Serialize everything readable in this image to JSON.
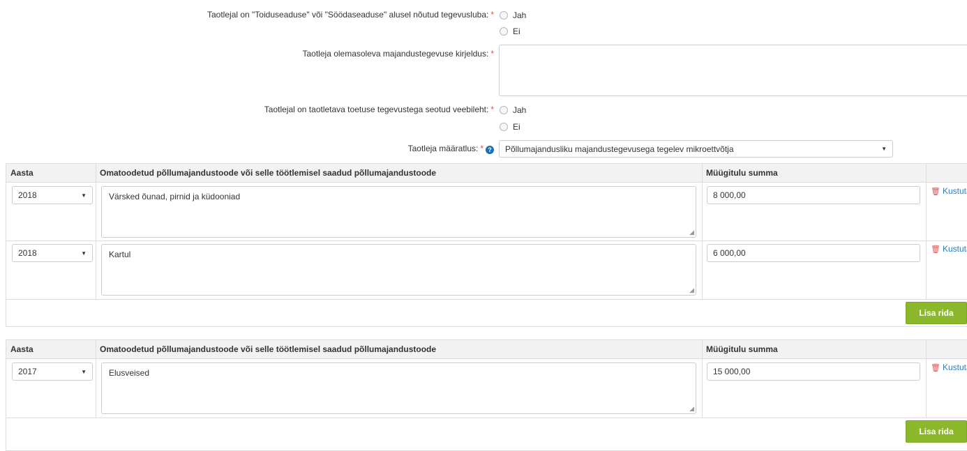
{
  "form": {
    "food_license": {
      "label": "Taotlejal on \"Toiduseaduse\" või \"Söödaseaduse\" alusel nõutud tegevusluba:",
      "required": "*",
      "options": [
        "Jah",
        "Ei"
      ]
    },
    "business_description": {
      "label": "Taotleja olemasoleva majandustegevuse kirjeldus:",
      "required": "*",
      "value": ""
    },
    "website": {
      "label": "Taotlejal on taotletava toetuse tegevustega seotud veebileht:",
      "required": "*",
      "options": [
        "Jah",
        "Ei"
      ]
    },
    "classification": {
      "label": "Taotleja määratlus:",
      "required": "*",
      "help_icon": "?",
      "value": "Põllumajandusliku majandustegevusega tegelev mikroettvõtja"
    }
  },
  "tables": [
    {
      "headers": {
        "year": "Aasta",
        "product": "Omatoodetud põllumajandustoode või selle töötlemisel saadud põllumajandustoode",
        "revenue": "Müügitulu summa"
      },
      "rows": [
        {
          "year": "2018",
          "product": "Värsked õunad, pirnid ja küdooniad",
          "revenue": "8 000,00",
          "delete": "Kustuta"
        },
        {
          "year": "2018",
          "product": "Kartul",
          "revenue": "6 000,00",
          "delete": "Kustuta"
        }
      ],
      "add_button": "Lisa rida"
    },
    {
      "headers": {
        "year": "Aasta",
        "product": "Omatoodetud põllumajandustoode või selle töötlemisel saadud põllumajandustoode",
        "revenue": "Müügitulu summa"
      },
      "rows": [
        {
          "year": "2017",
          "product": "Elusveised",
          "revenue": "15 000,00",
          "delete": "Kustuta"
        }
      ],
      "add_button": "Lisa rida"
    }
  ],
  "icons": {
    "select_caret": "▼",
    "resize_grip": "◢",
    "trash": "🗑"
  },
  "colors": {
    "required": "#d9534f",
    "link": "#337ab7",
    "help_icon": "#1a6fb5",
    "add_button": "#8cb82b",
    "table_header_bg": "#f2f2f2"
  }
}
